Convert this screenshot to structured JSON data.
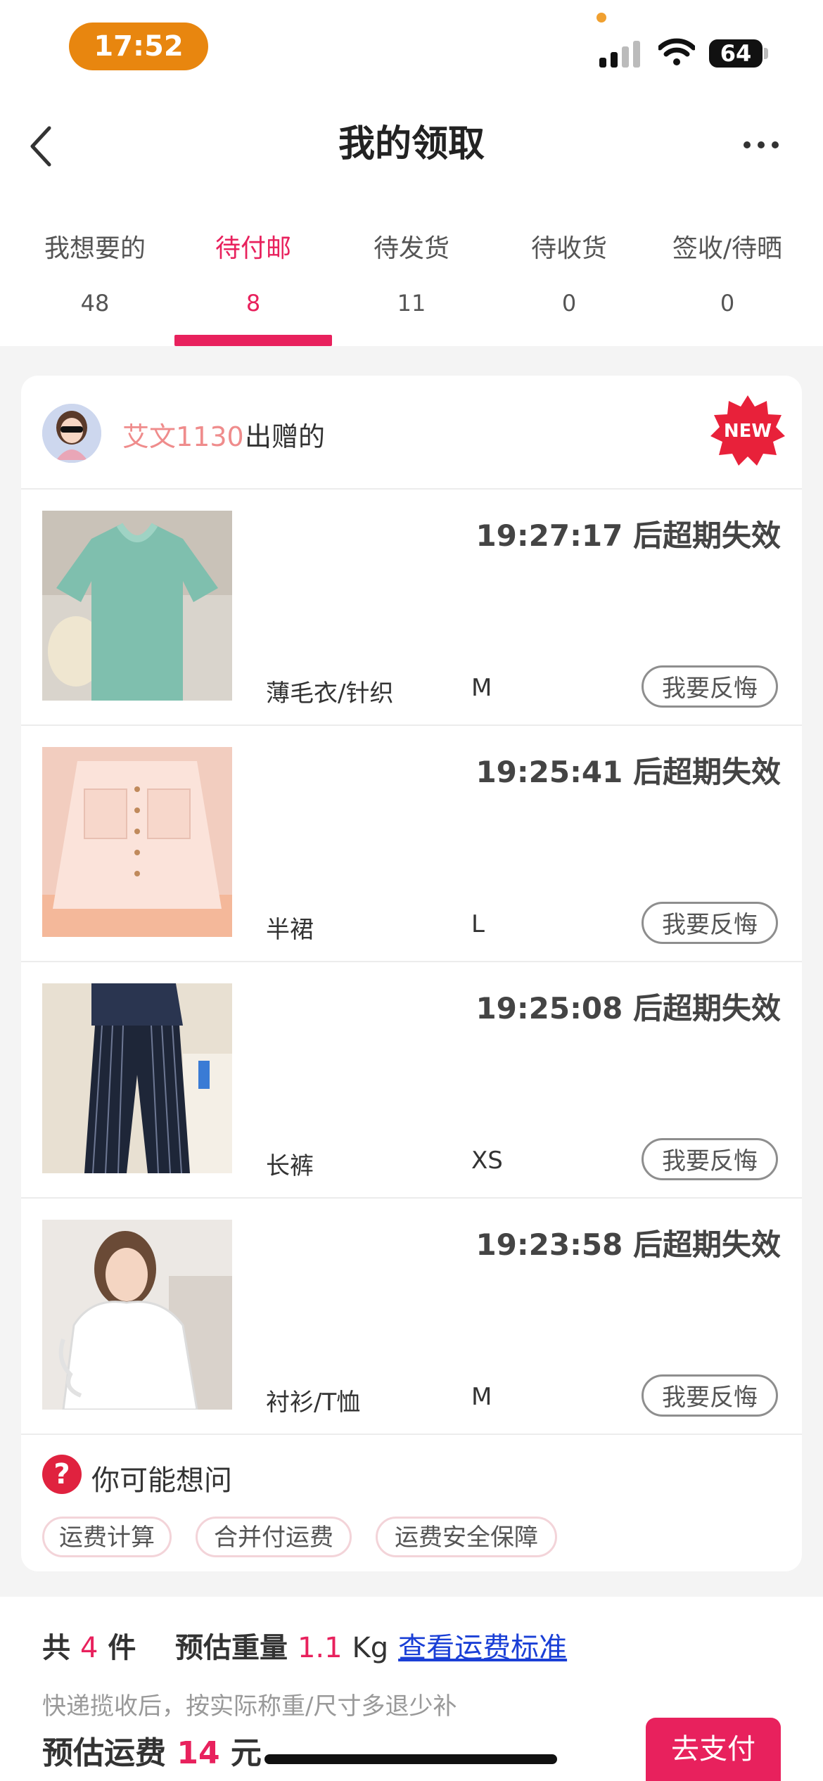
{
  "status_bar": {
    "time": "17:52",
    "battery": "64"
  },
  "nav": {
    "title": "我的领取"
  },
  "tabs": [
    {
      "label": "我想要的",
      "count": "48"
    },
    {
      "label": "待付邮",
      "count": "8"
    },
    {
      "label": "待发货",
      "count": "11"
    },
    {
      "label": "待收货",
      "count": "0"
    },
    {
      "label": "签收/待晒",
      "count": "0"
    }
  ],
  "donor": {
    "name": "艾文1130",
    "suffix": "出赠的",
    "badge": "NEW"
  },
  "items": [
    {
      "countdown": "19:27:17 后超期失效",
      "category": "薄毛衣/针织",
      "size": "M",
      "action": "我要反悔"
    },
    {
      "countdown": "19:25:41 后超期失效",
      "category": "半裙",
      "size": "L",
      "action": "我要反悔"
    },
    {
      "countdown": "19:25:08 后超期失效",
      "category": "长裤",
      "size": "XS",
      "action": "我要反悔"
    },
    {
      "countdown": "19:23:58 后超期失效",
      "category": "衬衫/T恤",
      "size": "M",
      "action": "我要反悔"
    }
  ],
  "faq": {
    "title": "你可能想问",
    "chips": [
      "运费计算",
      "合并付运费",
      "运费安全保障"
    ]
  },
  "summary": {
    "count_prefix": "共",
    "count": "4",
    "count_suffix": "件",
    "weight_label": "预估重量",
    "weight": "1.1",
    "weight_unit": "Kg",
    "link": "查看运费标准",
    "note": "快递揽收后，按实际称重/尺寸多退少补",
    "fee_label": "预估运费",
    "fee": "14",
    "fee_unit": "元",
    "pay_button": "去支付"
  },
  "colors": {
    "accent": "#e8215d",
    "time_pill": "#e8860f",
    "link": "#1a3fd6"
  }
}
